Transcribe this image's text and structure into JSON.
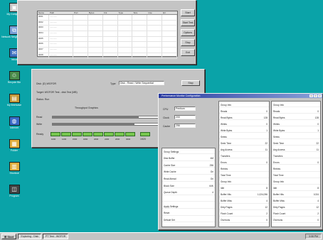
{
  "desktop": {
    "icons": [
      {
        "label": "My Computer",
        "glyph": "▣",
        "color": "#c8c8c8"
      },
      {
        "label": "Network Neighborhood",
        "glyph": "⧉",
        "color": "#7aa0d8"
      },
      {
        "label": "Inbox",
        "glyph": "✉",
        "color": "#3d6fc0"
      },
      {
        "label": "Recycle Bin",
        "glyph": "♲",
        "color": "#4a8c4a"
      },
      {
        "label": "My Briefcase",
        "glyph": "▤",
        "color": "#c89a3a"
      },
      {
        "label": "Internet",
        "glyph": "◍",
        "color": "#3a6ac8"
      },
      {
        "label": "Folder",
        "glyph": "▦",
        "color": "#e0b040"
      },
      {
        "label": "Shortcut",
        "glyph": "▥",
        "color": "#e0b040"
      },
      {
        "label": "Program",
        "glyph": "◫",
        "color": "#444"
      }
    ]
  },
  "window1": {
    "columns": [
      "Name",
      "Path",
      "Port",
      "Bytes",
      "Cnt",
      "Type",
      "Size",
      "Use",
      "Err"
    ],
    "rows": [
      [
        "0001",
        "............",
        "",
        "",
        "",
        "",
        "",
        "",
        ""
      ],
      [
        "0002",
        "............",
        "",
        "",
        "",
        "",
        "",
        "",
        ""
      ],
      [
        "0003",
        "............",
        "",
        "",
        "",
        "",
        "",
        "",
        ""
      ],
      [
        "0004",
        "............",
        "",
        "",
        "",
        "",
        "",
        "",
        ""
      ],
      [
        "0005",
        "............",
        "",
        "",
        "",
        "",
        "",
        "",
        ""
      ],
      [
        "0006",
        "............",
        "",
        "",
        "",
        "",
        "",
        "",
        ""
      ],
      [
        "0007",
        "............",
        "",
        "",
        "",
        "",
        "",
        "",
        ""
      ],
      [
        "0008",
        "............",
        "",
        "",
        "",
        "",
        "",
        "",
        ""
      ]
    ],
    "buttons": [
      "Start",
      "Start Test",
      "Options",
      "Stop",
      "Exit"
    ]
  },
  "window2": {
    "lines": [
      "Disk: (D) WGFOR",
      "Target: WGFOR Test - disk Test (MB)",
      "Status: Run"
    ],
    "field_label": "Type",
    "field_value": "Disk - Read / Write Sequential",
    "button_label": "Stop",
    "group_label": "Throughput Graphics",
    "bar_labels": [
      "Read",
      "Write"
    ],
    "bar_values": [
      0.82,
      0.78
    ],
    "meter_row_label": "Ready",
    "meter_count": 8,
    "meter_captions": [
      "1000",
      "1200",
      "1500",
      "1800",
      "2000",
      "2400",
      "2600",
      "3000"
    ],
    "side_value": "1920",
    "tick_labels": [
      "1",
      "2"
    ]
  },
  "window3": {
    "title": "Performance Monitor Configuration",
    "fields": [
      {
        "label": "CPU",
        "value": "Pentium"
      },
      {
        "label": "Clock",
        "value": "200"
      },
      {
        "label": "Cache",
        "value": "256"
      }
    ],
    "left_list": [
      {
        "k": "Group Settings",
        "v": ""
      },
      {
        "k": "Disk Buffer",
        "v": "4M"
      },
      {
        "k": "Cache Size",
        "v": "256"
      },
      {
        "k": "Write Cache",
        "v": "On"
      },
      {
        "k": "Read Ahead",
        "v": "On"
      },
      {
        "k": "Block Size",
        "v": "64K"
      },
      {
        "k": "Queue Depth",
        "v": "4"
      },
      {
        "k": "",
        "v": ""
      },
      {
        "k": "Apply Settings",
        "v": ""
      },
      {
        "k": "Reset",
        "v": ""
      },
      {
        "k": "Default Set",
        "v": ""
      }
    ],
    "mid_list": [
      {
        "k": "Group Info",
        "v": ""
      },
      {
        "k": "Reads",
        "v": "0"
      },
      {
        "k": "Read Bytes",
        "v": "128"
      },
      {
        "k": "Writes",
        "v": "0"
      },
      {
        "k": "Write Bytes",
        "v": "1"
      },
      {
        "k": "Seeks",
        "v": ""
      },
      {
        "k": "Seek Time",
        "v": "22"
      },
      {
        "k": "Avg Access",
        "v": "11"
      },
      {
        "k": "Transfers",
        "v": ""
      },
      {
        "k": "Errors",
        "v": "0"
      },
      {
        "k": "Retries",
        "v": ""
      },
      {
        "k": "Total Time",
        "v": ""
      },
      {
        "k": "Group Info",
        "v": ""
      },
      {
        "k": "Idle",
        "v": "8"
      },
      {
        "k": "Buffer Hits",
        "v": "1,024,096"
      },
      {
        "k": "Buffer Miss",
        "v": "4"
      },
      {
        "k": "Dirty Pages",
        "v": "12"
      },
      {
        "k": "Flush Count",
        "v": "2"
      },
      {
        "k": "Overruns",
        "v": "0"
      }
    ],
    "right_list": [
      {
        "k": "Group Info",
        "v": ""
      },
      {
        "k": "Reads",
        "v": "0"
      },
      {
        "k": "Read Bytes",
        "v": "128"
      },
      {
        "k": "Writes",
        "v": "0"
      },
      {
        "k": "Write Bytes",
        "v": "1"
      },
      {
        "k": "Seeks",
        "v": ""
      },
      {
        "k": "Seek Time",
        "v": "22"
      },
      {
        "k": "Avg Access",
        "v": "11"
      },
      {
        "k": "Transfers",
        "v": ""
      },
      {
        "k": "Errors",
        "v": "0"
      },
      {
        "k": "Retries",
        "v": ""
      },
      {
        "k": "Total Time",
        "v": ""
      },
      {
        "k": "Group Info",
        "v": ""
      },
      {
        "k": "Idle",
        "v": "8"
      },
      {
        "k": "Buffer Hits",
        "v": "1024"
      },
      {
        "k": "Buffer Miss",
        "v": "4"
      },
      {
        "k": "Dirty Pages",
        "v": "12"
      },
      {
        "k": "Flush Count",
        "v": "2"
      },
      {
        "k": "Overruns",
        "v": "0"
      }
    ]
  },
  "taskbar": {
    "start_label": "Start",
    "items": [
      "Exploring - Disk",
      "PT Test - WGFOR"
    ],
    "clock": "3:08 PM"
  }
}
